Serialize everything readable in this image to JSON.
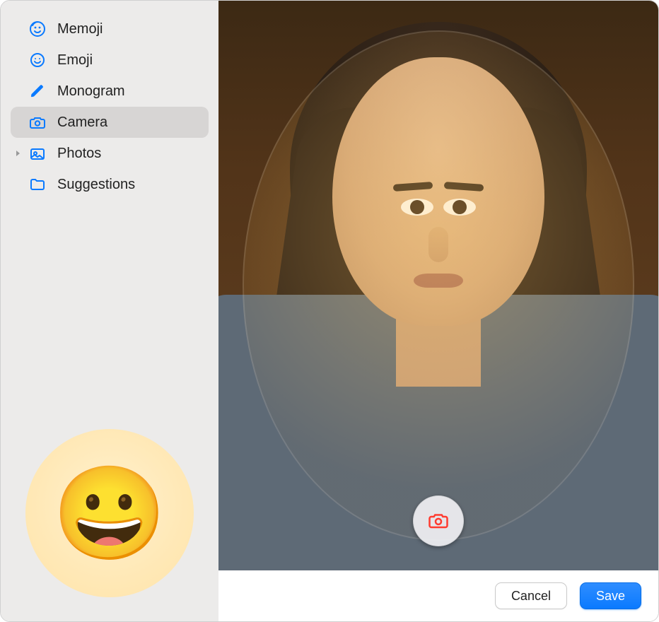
{
  "sidebar": {
    "items": [
      {
        "label": "Memoji",
        "icon": "memoji-face-icon",
        "selected": false,
        "disclosure": false
      },
      {
        "label": "Emoji",
        "icon": "smile-icon",
        "selected": false,
        "disclosure": false
      },
      {
        "label": "Monogram",
        "icon": "pencil-icon",
        "selected": false,
        "disclosure": false
      },
      {
        "label": "Camera",
        "icon": "camera-icon",
        "selected": true,
        "disclosure": false
      },
      {
        "label": "Photos",
        "icon": "photos-icon",
        "selected": false,
        "disclosure": true
      },
      {
        "label": "Suggestions",
        "icon": "folder-icon",
        "selected": false,
        "disclosure": false
      }
    ],
    "current_avatar_emoji": "😀"
  },
  "camera": {
    "shutter_icon": "camera-capture-icon"
  },
  "footer": {
    "cancel_label": "Cancel",
    "save_label": "Save"
  }
}
